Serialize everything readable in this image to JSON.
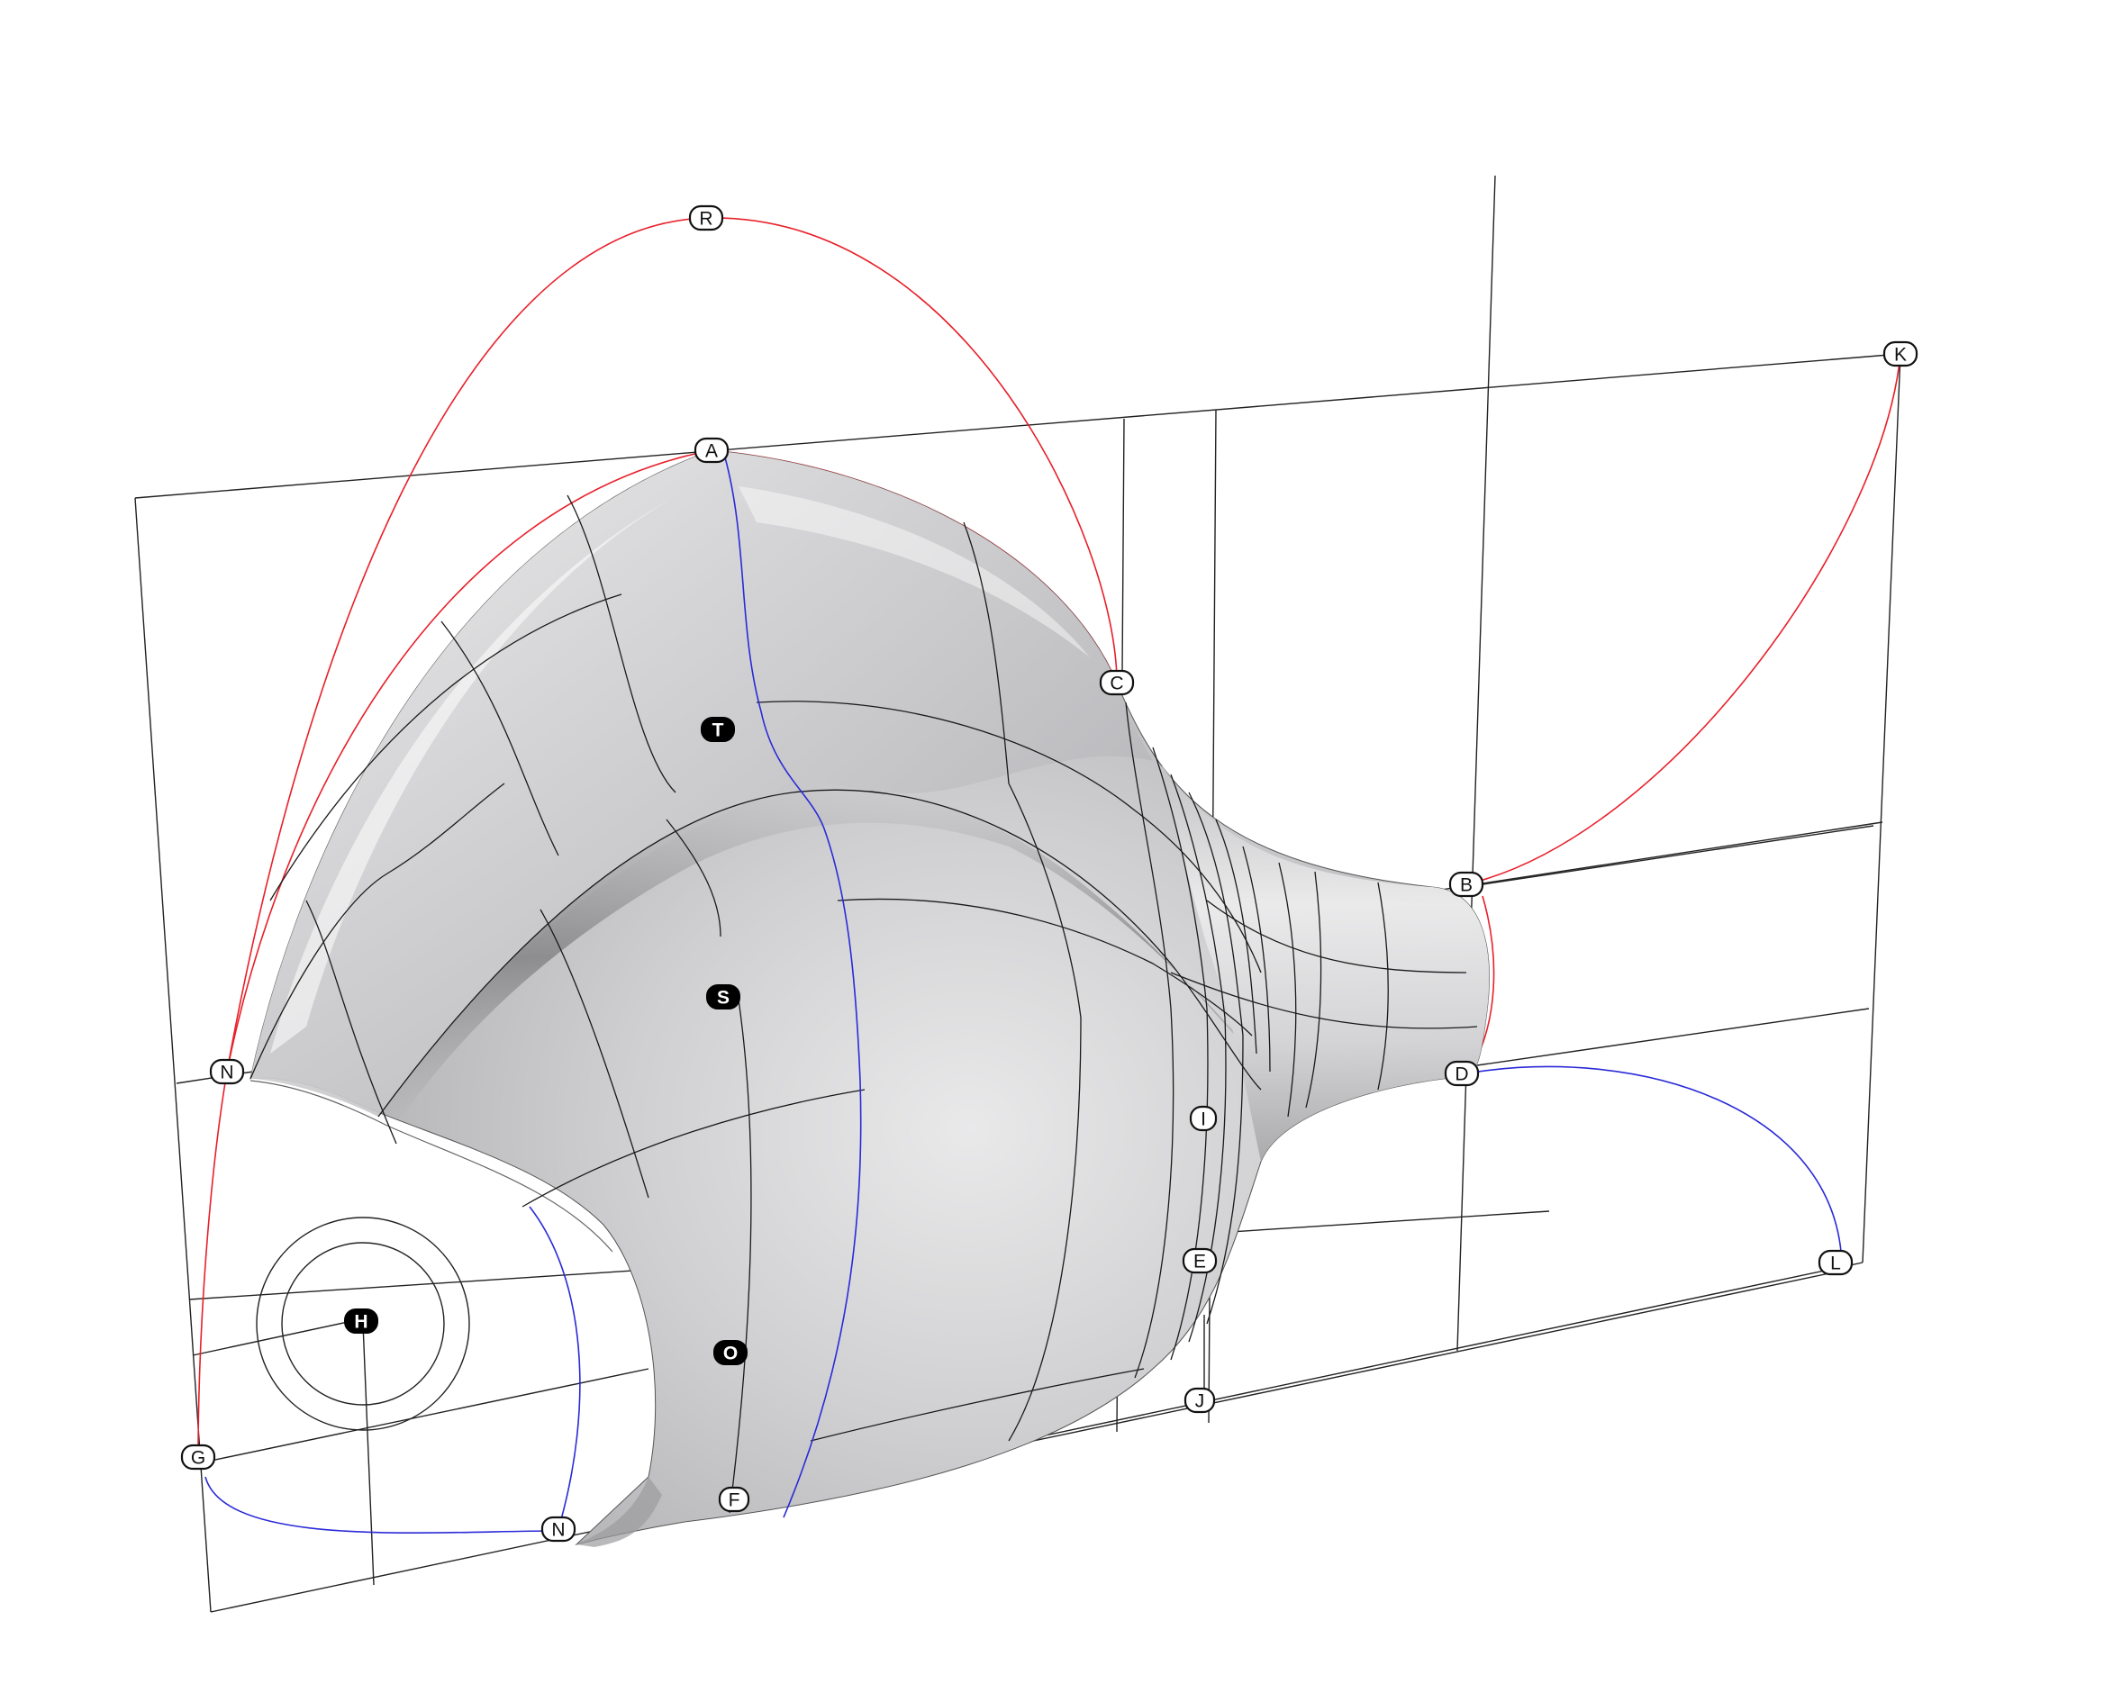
{
  "diagram": {
    "labels": {
      "A": "A",
      "B": "B",
      "C": "C",
      "D": "D",
      "E": "E",
      "F": "F",
      "G": "G",
      "H": "H",
      "I": "I",
      "J": "J",
      "K": "K",
      "L": "L",
      "N_top": "N",
      "N_bottom": "N",
      "O": "O",
      "R": "R",
      "S": "S",
      "T": "T"
    },
    "colors": {
      "background": "#ffffff",
      "grid": "#222222",
      "guide_curve_red": "#e8202a",
      "guide_curve_blue": "#2a2ad8",
      "surface_light": "#f2f2f2",
      "surface_mid": "#c4c4c6",
      "surface_dark": "#8a8a8c"
    },
    "icons": [
      "surface-shape",
      "control-point-marker"
    ]
  }
}
